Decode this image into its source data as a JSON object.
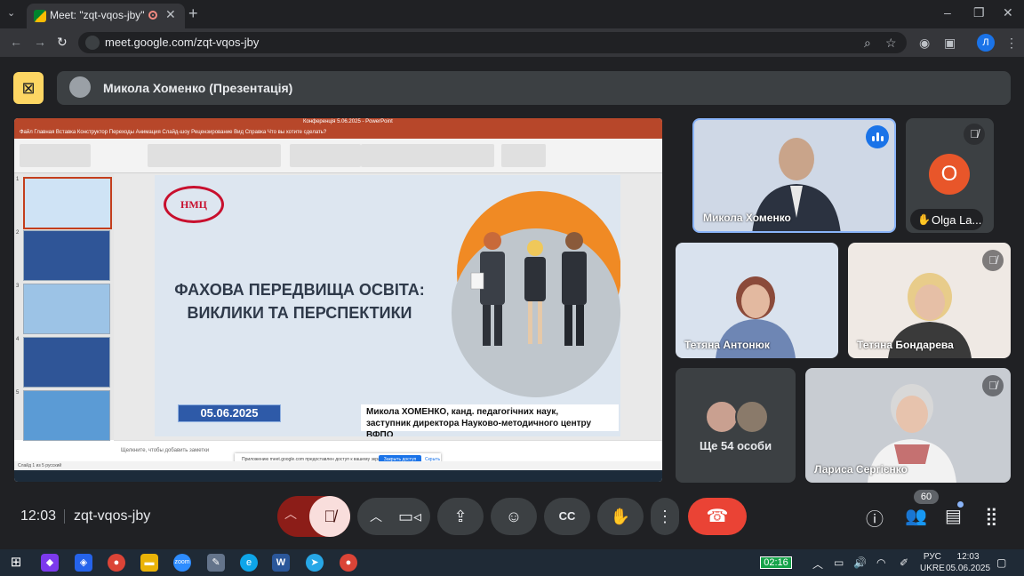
{
  "browser": {
    "tab_title": "Meet: \"zqt-vqos-jby\"",
    "url": "meet.google.com/zqt-vqos-jby",
    "profile_initial": "Л"
  },
  "meet": {
    "presenter_label": "Микола Хоменко (Презентація)",
    "meeting_time": "12:03",
    "meeting_code": "zqt-vqos-jby",
    "participant_count": "60"
  },
  "slide": {
    "logo_text": "НМЦ",
    "heading_line1": "ФАХОВА ПЕРЕДВИЩА ОСВІТА:",
    "heading_line2": "ВИКЛИКИ ТА ПЕРСПЕКТИКИ",
    "date": "05.06.2025",
    "author_line1": "Микола ХОМЕНКО, канд. педагогічних наук,",
    "author_line2": "заступник директора Науково-методичного центру ВФПО",
    "pp_window_title": "Конференція 5.06.2025 - PowerPoint",
    "pp_menu": "Файл   Главная   Вставка   Конструктор   Переходы   Анимация   Слайд-шоу   Рецензирование   Вид   Справка   Что вы хотите сделать?",
    "notes_placeholder": "Щелкните, чтобы добавить заметки",
    "share_notice": "Приложению meet.google.com предоставлен доступ к вашему экрану.",
    "share_button": "Закрыть доступ",
    "share_hide": "Скрыть",
    "status_left": "Слайд 1 из 5   русский",
    "thumb_numbers": [
      "1",
      "2",
      "3",
      "4",
      "5"
    ]
  },
  "participants": [
    {
      "name": "Микола Хоменко"
    },
    {
      "name": "Olga La..."
    },
    {
      "name": "Тетяна Антонюк"
    },
    {
      "name": "Тетяна Бондарева"
    },
    {
      "name": "Ще 54 особи"
    },
    {
      "name": "Лариса Сергієнко"
    }
  ],
  "ollie_initial": "O",
  "taskbar": {
    "timer": "02:16",
    "lang_line1": "РУС",
    "lang_line2": "UKRE",
    "time": "12:03",
    "date": "05.06.2025"
  },
  "colors": {
    "end_call": "#ea4335",
    "mic_muted": "#f9dedc",
    "present_badge": "#fdd663",
    "powerpoint": "#b7472a"
  }
}
